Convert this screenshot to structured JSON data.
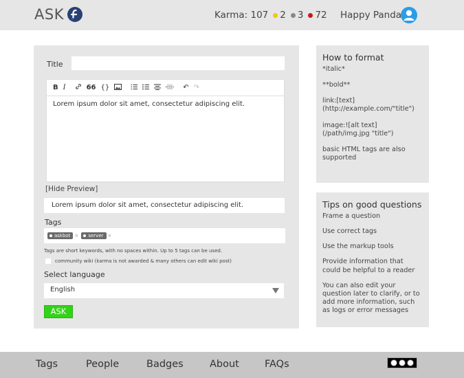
{
  "header": {
    "logo_text": "ASK",
    "karma_label": "Karma:",
    "karma_value": "107",
    "gold_count": "2",
    "silver_count": "3",
    "bronze_count": "72",
    "username": "Happy Panda",
    "colors": {
      "gold": "#f5c518",
      "silver": "#888888",
      "bronze": "#c81a1a",
      "avatar": "#2b9de8"
    }
  },
  "form": {
    "title_label": "Title",
    "title_value": "",
    "toolbar": {
      "bold": "B",
      "italic": "I",
      "link": "🔗",
      "quote": "❝❝",
      "code": "{}",
      "image": "▣",
      "numbered_list": "☰",
      "bulleted_list": "☰",
      "heading": "☰",
      "hr": "≡",
      "undo": "↶",
      "redo": "↷"
    },
    "editor_text": "Lorem ipsum dolor sit amet, consectetur adipiscing elit.",
    "hide_preview_label": "[Hide Preview]",
    "preview_text": "Lorem ipsum dolor sit amet, consectetur adipiscing elit.",
    "tags_label": "Tags",
    "tags": [
      {
        "name": "askbot",
        "remove": "×"
      },
      {
        "name": "server",
        "remove": "×"
      }
    ],
    "tags_help": "Tags are short keywords, with no spaces within. Up to 5 tags can be used.",
    "wiki_label": "community wiki (karma is not awarded & many others can edit wiki post)",
    "language_label": "Select language",
    "language_value": "English",
    "ask_button": "ASK",
    "ask_color": "#33d21a"
  },
  "format_box": {
    "title": "How to format",
    "items": [
      "*italic*",
      "**bold**",
      "link:[text](http://example.com/\"title\")",
      "image:![alt text](/path/img.jpg \"title\")",
      "basic HTML tags are also supported"
    ]
  },
  "tips_box": {
    "title": "Tips on good questions",
    "items": [
      "Frame a question",
      "Use correct tags",
      "Use the markup tools",
      "Provide information that could be helpful to a reader",
      "You can also edit your question later to clarify, or to add more information, such as logs or error messages"
    ]
  },
  "footer": {
    "links": [
      "Tags",
      "People",
      "Badges",
      "About",
      "FAQs"
    ]
  }
}
